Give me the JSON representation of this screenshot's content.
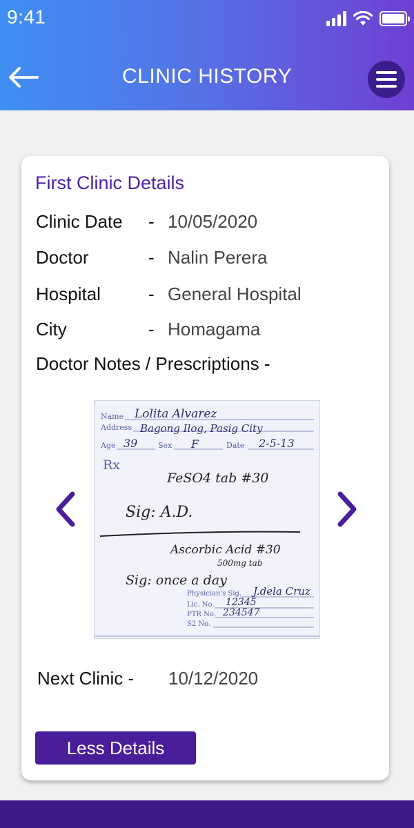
{
  "status_bar": {
    "time": "9:41"
  },
  "header": {
    "title": "CLINIC HISTORY"
  },
  "card": {
    "title": "First Clinic Details",
    "rows": [
      {
        "label": "Clinic Date",
        "value": "10/05/2020"
      },
      {
        "label": "Doctor",
        "value": "Nalin Perera"
      },
      {
        "label": "Hospital",
        "value": "General Hospital"
      },
      {
        "label": "City",
        "value": "Homagama"
      }
    ],
    "separator": "-",
    "notes_label": "Doctor Notes / Prescriptions -",
    "next_clinic": {
      "label": "Next Clinic -",
      "value": "10/12/2020"
    },
    "less_button": "Less Details"
  },
  "prescription": {
    "name_label": "Name",
    "name": "Lolita Alvarez",
    "address_label": "Address",
    "address": "Bagong Ilog, Pasig City",
    "age_label": "Age",
    "age": "39",
    "sex_label": "Sex",
    "sex": "F",
    "date_label": "Date",
    "date": "2-5-13",
    "rx": "Rx",
    "line1": "FeSO4 tab #30",
    "sig1": "Sig: A.D.",
    "line2": "Ascorbic Acid #30",
    "line2b": "500mg tab",
    "sig2": "Sig: once a day",
    "physician_label": "Physician's Sig.",
    "physician": "J.dela Cruz",
    "lic_label": "Lic. No.",
    "lic": "12345",
    "ptr_label": "PTR No.",
    "ptr": "234547",
    "s2_label": "S2 No."
  },
  "colors": {
    "header_start": "#3f8ff2",
    "header_end": "#6f3fd2",
    "accent": "#4a22a3",
    "button": "#4a1e9b",
    "bottom_bar": "#3b1a88"
  }
}
